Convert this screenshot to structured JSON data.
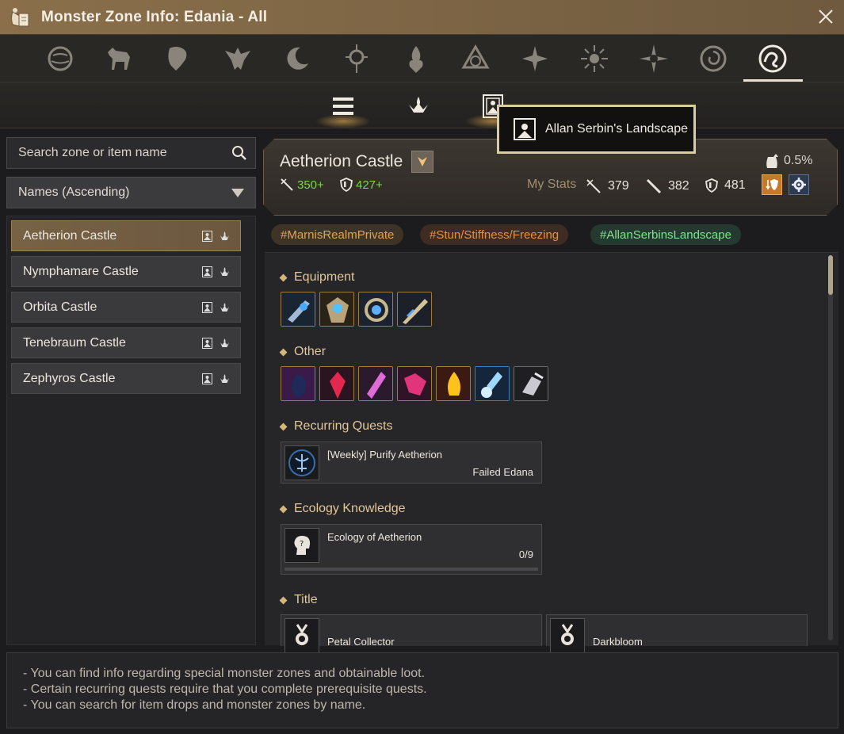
{
  "window": {
    "title": "Monster Zone Info: Edania - All"
  },
  "categories": [
    {
      "icon": "globe-icon"
    },
    {
      "icon": "horse-icon"
    },
    {
      "icon": "lion-icon"
    },
    {
      "icon": "eagle-icon"
    },
    {
      "icon": "moon-icon"
    },
    {
      "icon": "orb-icon"
    },
    {
      "icon": "flame-icon"
    },
    {
      "icon": "knot-icon"
    },
    {
      "icon": "star-icon"
    },
    {
      "icon": "sun-icon"
    },
    {
      "icon": "compass-icon"
    },
    {
      "icon": "spiral-icon"
    },
    {
      "icon": "swirl-icon",
      "active": true
    }
  ],
  "subtabs": [
    {
      "icon": "list-icon"
    },
    {
      "icon": "crown-flame-icon"
    },
    {
      "icon": "landscape-icon"
    }
  ],
  "tooltip": {
    "text": "Allan Serbin's Landscape"
  },
  "search": {
    "placeholder": "Search zone or item name"
  },
  "sort": {
    "label": "Names (Ascending)"
  },
  "zones": [
    {
      "name": "Aetherion Castle",
      "active": true
    },
    {
      "name": "Nymphamare Castle"
    },
    {
      "name": "Orbita Castle"
    },
    {
      "name": "Tenebraum Castle"
    },
    {
      "name": "Zephyros Castle"
    }
  ],
  "zone_header": {
    "name": "Aetherion Castle",
    "req_attack": "350+",
    "req_defense": "427+",
    "my_stats_label": "My Stats",
    "stat_attack": "379",
    "stat_accuracy": "382",
    "stat_defense": "481",
    "drop_rate": "0.5%"
  },
  "tags": [
    {
      "text": "#MarnisRealmPrivate",
      "color": "#d9a55a"
    },
    {
      "text": "#Stun/Stiffness/Freezing",
      "color": "#e5903f"
    },
    {
      "text": "#AllanSerbinsLandscape",
      "color": "#7fe08c"
    }
  ],
  "sections": {
    "equipment": "Equipment",
    "other": "Other",
    "recurring_quests": "Recurring Quests",
    "ecology": "Ecology Knowledge",
    "title": "Title"
  },
  "quest": {
    "name": "[Weekly] Purify Aetherion",
    "location": "Failed Edana"
  },
  "ecology": {
    "name": "Ecology of Aetherion",
    "progress": "0/9"
  },
  "titles": [
    {
      "name": "Petal Collector"
    },
    {
      "name": "Darkbloom"
    }
  ],
  "footer": {
    "line1": "- You can find info regarding special monster zones and obtainable loot.",
    "line2": "- Certain recurring quests require that you complete prerequisite quests.",
    "line3": "- You can search for item drops and monster zones by name."
  }
}
